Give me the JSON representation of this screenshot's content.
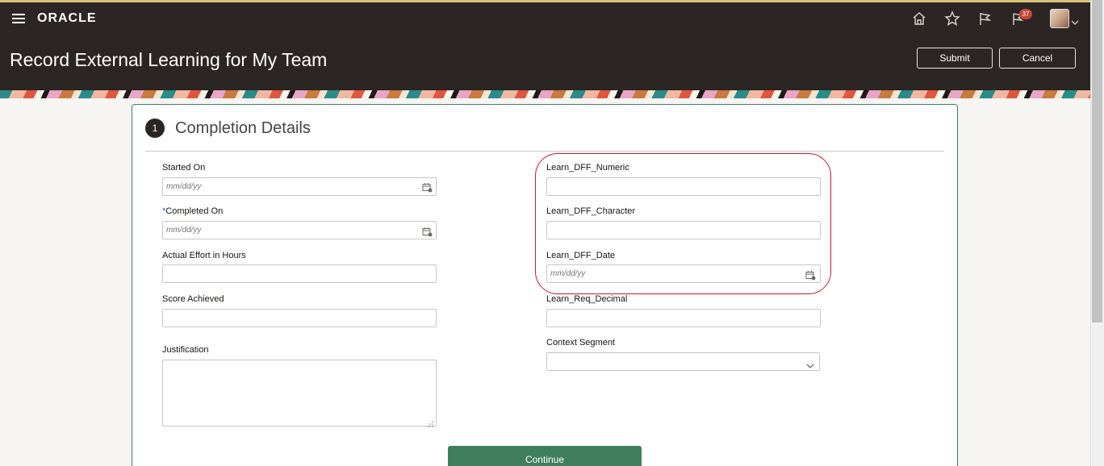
{
  "header": {
    "logo": "ORACLE",
    "title": "Record External Learning for My Team",
    "notification_count": "37",
    "submit_label": "Submit",
    "cancel_label": "Cancel",
    "icons": [
      "hamburger-icon",
      "home-icon",
      "star-icon",
      "flag-icon",
      "notifications-icon",
      "chevron-down-icon"
    ]
  },
  "section": {
    "step": "1",
    "title": "Completion Details"
  },
  "form_left": {
    "started_on": {
      "label": "Started On",
      "placeholder": "mm/dd/yy"
    },
    "completed_on": {
      "required_mark": "*",
      "label": "Completed On",
      "placeholder": "mm/dd/yy"
    },
    "actual_effort": {
      "label": "Actual Effort in Hours",
      "value": ""
    },
    "score": {
      "label": "Score Achieved",
      "value": ""
    },
    "justification": {
      "label": "Justification",
      "value": ""
    }
  },
  "form_right": {
    "dff_numeric": {
      "label": "Learn_DFF_Numeric",
      "value": ""
    },
    "dff_character": {
      "label": "Learn_DFF_Character",
      "value": ""
    },
    "dff_date": {
      "label": "Learn_DFF_Date",
      "placeholder": "mm/dd/yy"
    },
    "req_decimal": {
      "label": "Learn_Req_Decimal",
      "value": ""
    },
    "context_segment": {
      "label": "Context Segment",
      "value": ""
    }
  },
  "footer": {
    "continue_label": "Continue"
  },
  "colors": {
    "header_bg": "#2b2623",
    "accent_green": "#3f7f5f",
    "highlight_red": "#c41e2e",
    "badge_red": "#c74634"
  }
}
